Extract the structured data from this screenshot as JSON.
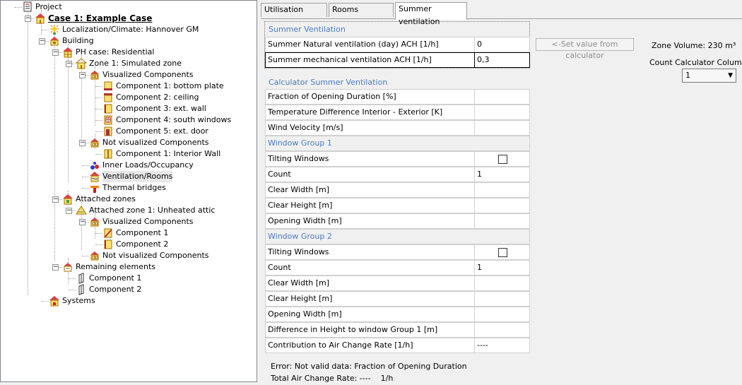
{
  "tree": [
    {
      "label": "Project",
      "icon": "project-icon"
    },
    {
      "label": "Case 1: Example Case",
      "icon": "house-icon"
    },
    {
      "label": "Localization/Climate: Hannover GM",
      "icon": "sun-icon"
    },
    {
      "label": "Building",
      "icon": "building-icon"
    },
    {
      "label": "PH case: Residential",
      "icon": "ph-house-icon"
    },
    {
      "label": "Zone 1: Simulated zone",
      "icon": "zone-icon"
    },
    {
      "label": "Visualized Components",
      "icon": "components-icon"
    },
    {
      "label": "Component 1: bottom plate",
      "icon": "bottom-plate-icon"
    },
    {
      "label": "Component 2: ceiling",
      "icon": "ceiling-icon"
    },
    {
      "label": "Component 3: ext. wall",
      "icon": "wall-icon"
    },
    {
      "label": "Component 4: south windows",
      "icon": "window-icon"
    },
    {
      "label": "Component 5: ext. door",
      "icon": "door-icon"
    },
    {
      "label": "Not visualized Components",
      "icon": "components-icon"
    },
    {
      "label": "Component 1: Interior Wall",
      "icon": "interior-wall-icon"
    },
    {
      "label": "Inner Loads/Occupancy",
      "icon": "loads-icon"
    },
    {
      "label": "Ventilation/Rooms",
      "icon": "ventilation-icon"
    },
    {
      "label": "Thermal bridges",
      "icon": "thermal-bridge-icon"
    },
    {
      "label": "Attached zones",
      "icon": "attached-zones-icon"
    },
    {
      "label": "Attached zone 1: Unheated attic",
      "icon": "attic-icon"
    },
    {
      "label": "Visualized Components",
      "icon": "components-icon"
    },
    {
      "label": "Component 1",
      "icon": "roof-component-icon"
    },
    {
      "label": "Component 2",
      "icon": "wall-icon"
    },
    {
      "label": "Not visualized Components",
      "icon": "components-icon"
    },
    {
      "label": "Remaining elements",
      "icon": "remaining-icon"
    },
    {
      "label": "Component 1",
      "icon": "panel-icon"
    },
    {
      "label": "Component 2",
      "icon": "panel-icon"
    },
    {
      "label": "Systems",
      "icon": "systems-icon"
    }
  ],
  "tabs": [
    "Utilisation Pattern",
    "Rooms ventilation",
    "Summer ventilation"
  ],
  "active_tab": "Summer ventilation",
  "summer": {
    "title": "Summer Ventilation",
    "natural_label": "Summer Natural ventilation (day) ACH  [1/h]",
    "natural_value": "0",
    "mechanical_label": "Summer mechanical ventilation ACH  [1/h]",
    "mechanical_value": "0,3"
  },
  "set_button": "<-Set value from calculator",
  "zone_volume": "Zone Volume: 230 m³",
  "count_columns_label": "Count Calculator Columns",
  "count_columns_value": "1",
  "calculator": {
    "title": "Calculator Summer Ventilation",
    "fraction_label": "Fraction of Opening Duration  [%]",
    "temp_diff_label": "Temperature Difference Interior - Exterior  [K]",
    "wind_label": "Wind Velocity  [m/s]",
    "group1": {
      "title": "Window Group 1",
      "tilting_label": "Tilting Windows",
      "count_label": "Count",
      "count_value": "1",
      "clear_width_label": "Clear Width  [m]",
      "clear_height_label": "Clear Height  [m]",
      "opening_width_label": "Opening Width  [m]"
    },
    "group2": {
      "title": "Window Group 2",
      "tilting_label": "Tilting Windows",
      "count_label": "Count",
      "count_value": "1",
      "clear_width_label": "Clear Width  [m]",
      "clear_height_label": "Clear Height  [m]",
      "opening_width_label": "Opening Width  [m]",
      "height_diff_label": "Difference in Height to window Group 1  [m]"
    },
    "contribution_label": "Contribution to Air Change Rate  [1/h]",
    "contribution_value": "----"
  },
  "error_text": "Error: Not valid data: Fraction of Opening Duration",
  "total_text": "Total Air Change Rate: ----    1/h"
}
